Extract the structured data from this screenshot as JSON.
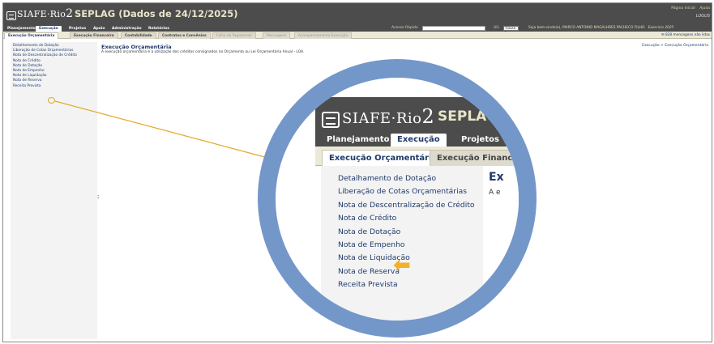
{
  "app": {
    "logo_text": "SIAFE",
    "logo_dot": "·",
    "logo_rio": "Rio",
    "logo_num": "2",
    "org_title": "SEPLAG (Dados de 24/12/2025)",
    "top_links": [
      "Página Inicial",
      "Ajuda"
    ],
    "brand_small": "LOGUS"
  },
  "main_nav": {
    "items": [
      {
        "label": "Planejamento",
        "active": false
      },
      {
        "label": "Execução",
        "active": true
      },
      {
        "label": "Projetos",
        "active": false
      },
      {
        "label": "Apoio",
        "active": false
      },
      {
        "label": "Administração",
        "active": false
      },
      {
        "label": "Relatórios",
        "active": false
      }
    ],
    "quick_access_label": "Acesso Rápido",
    "quick_access_value": "",
    "ug_label": "UG",
    "ug_value": "TODAS",
    "welcome_text": "Seja bem-vindo(a), MARCO ANTONIO MAGALHÃES PACHECO FILHO",
    "exercise_text": "Exercício 2025"
  },
  "sub_nav": {
    "items": [
      {
        "label": "Execução Orçamentária",
        "state": "active"
      },
      {
        "label": "Execução Financeira",
        "state": "normal"
      },
      {
        "label": "Contabilidade",
        "state": "normal"
      },
      {
        "label": "Contratos e Convênios",
        "state": "normal"
      },
      {
        "label": "Folha de Pagamento",
        "state": "dim"
      },
      {
        "label": "Mensagens",
        "state": "dim"
      },
      {
        "label": "Acompanhamento Execução",
        "state": "dim"
      }
    ],
    "messages_text": "828 mensagens não lidas"
  },
  "sidebar": {
    "items": [
      "Detalhamento de Dotação",
      "Liberação de Cotas Orçamentárias",
      "Nota de Descentralização de Crédito",
      "Nota de Crédito",
      "Nota de Dotação",
      "Nota de Empenho",
      "Nota de Liquidação",
      "Nota de Reserva",
      "Receita Prevista"
    ],
    "highlighted_index": 7
  },
  "content": {
    "title": "Execução Orçamentária",
    "description": "A execução orçamentária é a utilização dos créditos consignados no Orçamento ou Lei Orçamentária Anual - LOA.",
    "breadcrumb": "Execução > Execução Orçamentária",
    "splitter_glyph": "⁝"
  },
  "zoom": {
    "title_partial": "Ex",
    "desc_partial": "A e",
    "sub_partial_2": "Execução Financ",
    "arrow_glyph": "⬅",
    "ring_color": "#7497c9",
    "highlight_color": "#f4b028"
  },
  "colors": {
    "header_bg": "#4c4c4c",
    "link_blue": "#1f3a6b",
    "title_cream": "#e8e4c8"
  }
}
